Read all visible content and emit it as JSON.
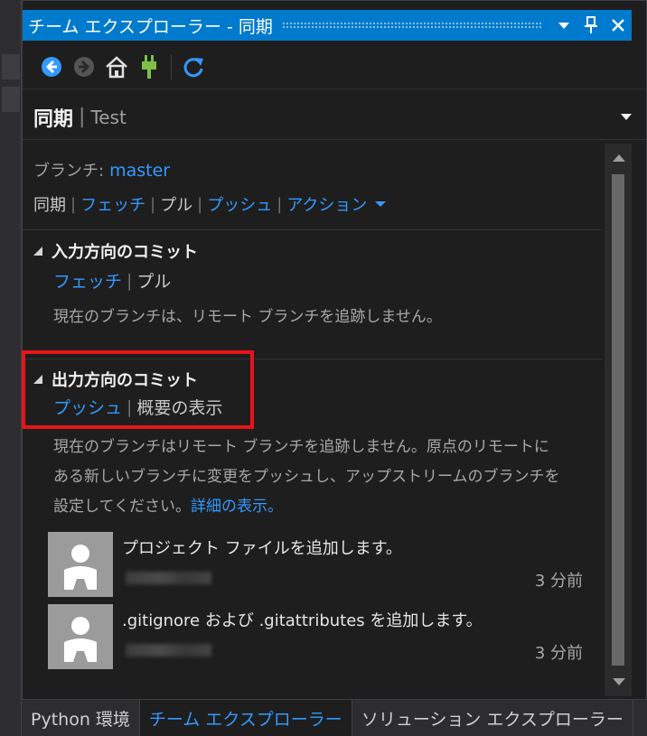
{
  "window": {
    "title": "チーム エクスプローラー - 同期",
    "buttons": {
      "dropdown": "▾",
      "pin": "📌",
      "close": "✕"
    }
  },
  "toolbar": {
    "icons": [
      "back-icon",
      "forward-icon",
      "home-icon",
      "connect-plug-icon",
      "refresh-icon"
    ]
  },
  "header": {
    "title": "同期",
    "separator": "|",
    "subtitle": "Test"
  },
  "branch": {
    "label": "ブランチ:",
    "value": "master"
  },
  "actions": [
    "同期",
    "フェッチ",
    "プル",
    "プッシュ",
    "アクション"
  ],
  "incoming": {
    "title": "入力方向のコミット",
    "links": [
      "フェッチ",
      "プル"
    ],
    "message": "現在のブランチは、リモート ブランチを追跡しません。"
  },
  "outgoing": {
    "title": "出力方向のコミット",
    "links": [
      "プッシュ",
      "概要の表示"
    ],
    "message_lines": [
      "現在のブランチはリモート ブランチを追跡しません。原点のリモートに",
      "ある新しいブランチに変更をプッシュし、アップストリームのブランチを",
      "設定してください。"
    ],
    "more_link": "詳細の表示。"
  },
  "commits": [
    {
      "message": "プロジェクト ファイルを追加します。",
      "time": "3 分前"
    },
    {
      "message": ".gitignore および .gitattributes を追加します。",
      "time": "3 分前"
    }
  ],
  "bottom_tabs": [
    {
      "label": "Python 環境",
      "active": false
    },
    {
      "label": "チーム エクスプローラー",
      "active": true
    },
    {
      "label": "ソリューション エクスプローラー",
      "active": false
    }
  ],
  "colors": {
    "accent": "#007acc",
    "link": "#3399ff",
    "highlight": "#e8141b"
  }
}
